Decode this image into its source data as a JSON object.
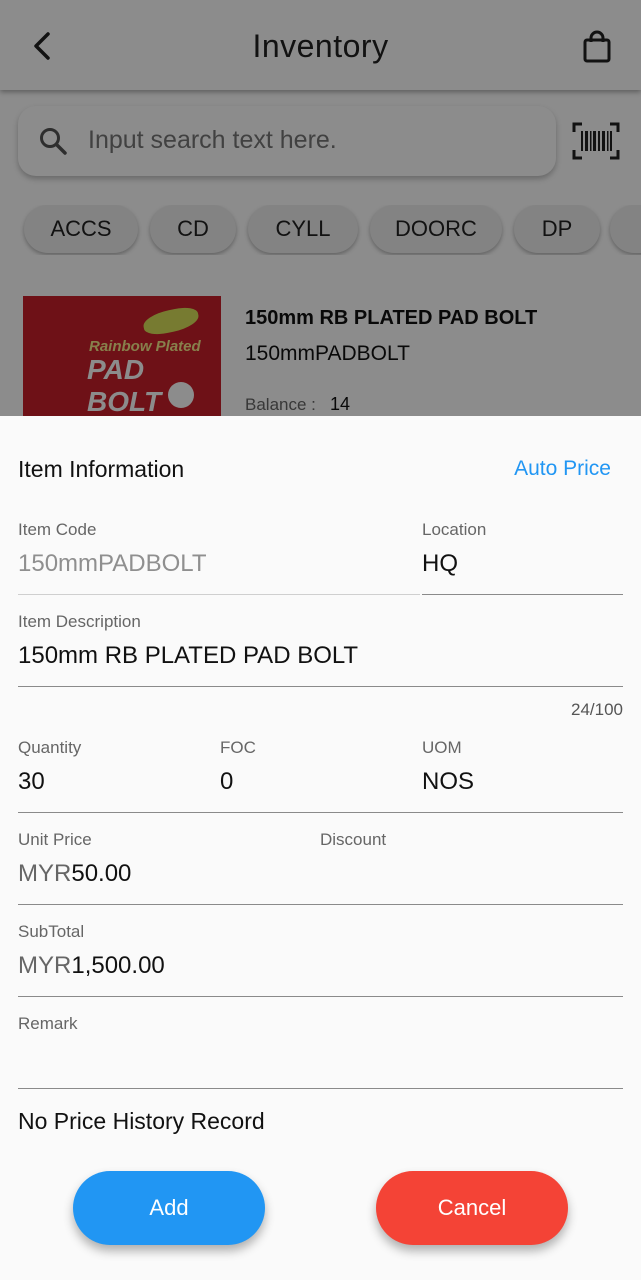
{
  "appbar": {
    "title": "Inventory",
    "icons": [
      "back-arrow-icon",
      "shopping-bag-icon"
    ]
  },
  "search": {
    "placeholder": "Input search text here.",
    "icons": [
      "search-icon",
      "barcode-scan-icon"
    ]
  },
  "categories": [
    "ACCS",
    "CD",
    "CYLL",
    "DOORC",
    "DP"
  ],
  "product": {
    "name": "150mm RB PLATED PAD BOLT",
    "code": "150mmPADBOLT",
    "balance_label": "Balance :",
    "balance_value": "14",
    "image_text_top": "Rainbow Plated",
    "image_text_main": "PAD BOLT"
  },
  "sheet": {
    "header": "Item Information",
    "auto_price": "Auto Price",
    "item_code": {
      "label": "Item Code",
      "value": "150mmPADBOLT"
    },
    "location": {
      "label": "Location",
      "value": "HQ"
    },
    "item_description": {
      "label": "Item Description",
      "value": "150mm RB PLATED PAD BOLT",
      "counter": "24/100"
    },
    "quantity": {
      "label": "Quantity",
      "value": "30"
    },
    "foc": {
      "label": "FOC",
      "value": "0"
    },
    "uom": {
      "label": "UOM",
      "value": "NOS"
    },
    "unit_price": {
      "label": "Unit Price",
      "currency": "MYR",
      "value": "50.00"
    },
    "discount": {
      "label": "Discount",
      "value": ""
    },
    "subtotal": {
      "label": "SubTotal",
      "currency": "MYR",
      "value": "1,500.00"
    },
    "remark": {
      "label": "Remark",
      "value": ""
    },
    "price_history": "No Price History Record",
    "add_button": "Add",
    "cancel_button": "Cancel"
  },
  "colors": {
    "accent": "#2196f3",
    "danger": "#f44336"
  }
}
